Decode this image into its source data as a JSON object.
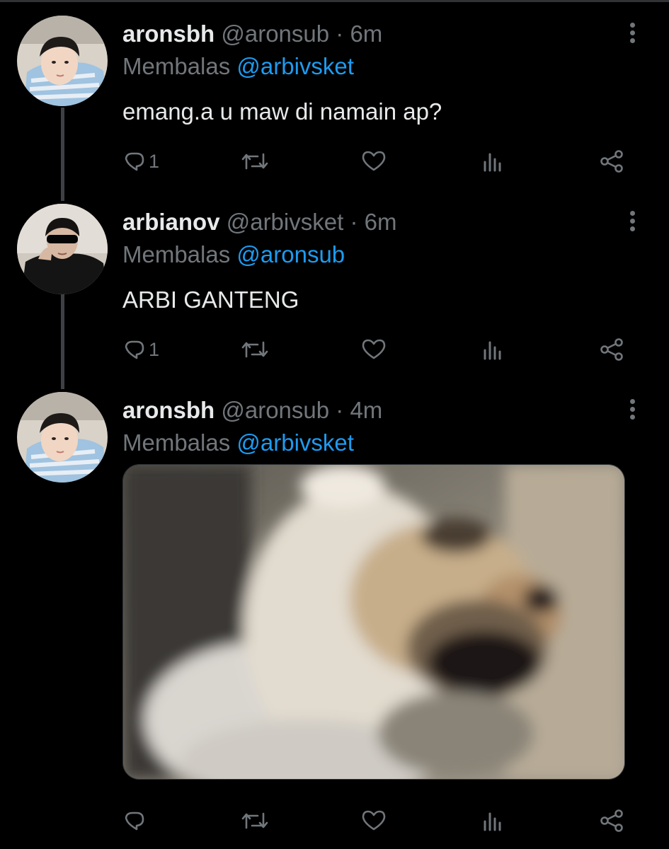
{
  "tweets": [
    {
      "display_name": "aronsbh",
      "handle": "@aronsub",
      "time": "· 6m",
      "reply_prefix": "Membalas",
      "reply_to": "@arbivsket",
      "text": "emang.a u maw di namain ap?",
      "reply_count": "1",
      "avatar": "profile-photo-boy-striped-shirt"
    },
    {
      "display_name": "arbianov",
      "handle": "@arbivsket",
      "time": "· 6m",
      "reply_prefix": "Membalas",
      "reply_to": "@aronsub",
      "text": "ARBI GANTENG",
      "reply_count": "1",
      "avatar": "profile-photo-sunglasses-black-jacket"
    },
    {
      "display_name": "aronsbh",
      "handle": "@aronsub",
      "time": "· 4m",
      "reply_prefix": "Membalas",
      "reply_to": "@arbivsket",
      "text": "",
      "reply_count": "",
      "avatar": "profile-photo-boy-striped-shirt",
      "media": "blurry-dog-photo"
    }
  ],
  "icons": {
    "reply": "reply-icon",
    "retweet": "retweet-icon",
    "like": "heart-icon",
    "views": "views-icon",
    "share": "share-icon",
    "more": "more-vertical-icon"
  },
  "colors": {
    "background": "#000000",
    "text": "#e7e9ea",
    "muted": "#71767b",
    "accent": "#1d9bf0"
  }
}
